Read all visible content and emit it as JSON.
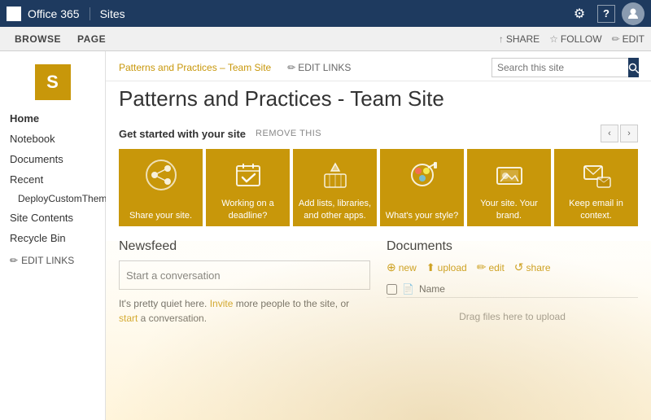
{
  "topbar": {
    "grid_icon": "⊞",
    "office365_label": "Office 365",
    "sites_label": "Sites",
    "gear_icon": "⚙",
    "help_icon": "?",
    "avatar_icon": "👤"
  },
  "subnav": {
    "items": [
      "BROWSE",
      "PAGE"
    ],
    "actions": [
      {
        "label": "SHARE",
        "icon": "↑"
      },
      {
        "label": "FOLLOW",
        "icon": "☆"
      },
      {
        "label": "EDIT",
        "icon": "✏"
      }
    ]
  },
  "header": {
    "breadcrumb": "Patterns and Practices – Team Site",
    "edit_links_label": "EDIT LINKS",
    "search_placeholder": "Search this site",
    "page_title": "Patterns and Practices - Team Site"
  },
  "sidebar": {
    "logo_letter": "S",
    "items": [
      {
        "label": "Home",
        "active": true
      },
      {
        "label": "Notebook"
      },
      {
        "label": "Documents"
      },
      {
        "label": "Recent"
      },
      {
        "label": "DeployCustomTheme",
        "sub": true
      },
      {
        "label": "Site Contents"
      },
      {
        "label": "Recycle Bin"
      }
    ],
    "edit_links_label": "EDIT LINKS",
    "edit_icon": "✏"
  },
  "get_started": {
    "title": "Get started with your site",
    "remove_label": "REMOVE THIS",
    "prev_icon": "‹",
    "next_icon": "›",
    "tiles": [
      {
        "label": "Share your site.",
        "icon": "share"
      },
      {
        "label": "Working on a deadline?",
        "icon": "deadline"
      },
      {
        "label": "Add lists, libraries, and other apps.",
        "icon": "apps"
      },
      {
        "label": "What's your style?",
        "icon": "style"
      },
      {
        "label": "Your site. Your brand.",
        "icon": "brand"
      },
      {
        "label": "Keep email in context.",
        "icon": "email"
      }
    ]
  },
  "newsfeed": {
    "title": "Newsfeed",
    "input_placeholder": "Start a conversation",
    "hint_before": "It's pretty quiet here. ",
    "invite_text": "Invite",
    "hint_middle": " more people to the site, or ",
    "start_text": "start",
    "hint_after": " a conversation."
  },
  "documents": {
    "title": "Documents",
    "actions": [
      {
        "label": "new",
        "icon": "⊕"
      },
      {
        "label": "upload",
        "icon": "⬆"
      },
      {
        "label": "edit",
        "icon": "✏"
      },
      {
        "label": "share",
        "icon": "↺"
      }
    ],
    "col_name": "Name",
    "empty_hint": "Drag files here to upload"
  },
  "colors": {
    "brand_gold": "#c8970a",
    "brand_dark_blue": "#1e3a5f",
    "tile_bg": "#c8970a"
  }
}
